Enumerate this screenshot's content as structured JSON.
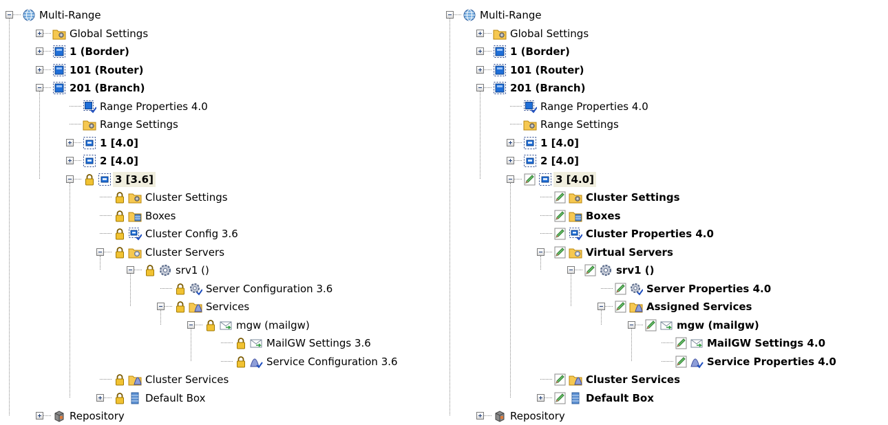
{
  "colors": {
    "accent_blue": "#1f6fd8",
    "selection_background": "#f0eede",
    "lock_yellow": "#f1c232",
    "folder_yellow": "#f6c851",
    "edit_green": "#4caf50"
  },
  "icons": {
    "lock": "lock-icon",
    "edit": "edit-pencil-icon",
    "globe": "globe-icon",
    "settings_folder": "settings-folder-icon",
    "range": "range-icon",
    "range_properties": "range-properties-icon",
    "cluster": "cluster-icon",
    "boxes_folder": "boxes-folder-icon",
    "cluster_config": "cluster-config-icon",
    "servers_folder": "servers-folder-icon",
    "server": "server-gear-icon",
    "server_config": "server-config-icon",
    "services_folder": "services-folder-icon",
    "mail_service": "mail-service-icon",
    "mail_settings": "mail-settings-icon",
    "service_config": "service-config-icon",
    "default_box": "default-box-icon",
    "repository": "repository-icon"
  },
  "left_tree": {
    "nodes": [
      {
        "label": "Multi-Range"
      },
      {
        "label": "Global Settings"
      },
      {
        "label": "1 (Border)"
      },
      {
        "label": "101 (Router)"
      },
      {
        "label": "201 (Branch)"
      },
      {
        "label": "Range Properties 4.0"
      },
      {
        "label": "Range Settings"
      },
      {
        "label": "1 [4.0]"
      },
      {
        "label": "2 [4.0]"
      },
      {
        "label": "3 [3.6]"
      },
      {
        "label": "Cluster Settings"
      },
      {
        "label": "Boxes"
      },
      {
        "label": "Cluster Config 3.6"
      },
      {
        "label": "Cluster Servers"
      },
      {
        "label": "srv1 ()"
      },
      {
        "label": "Server Configuration 3.6"
      },
      {
        "label": "Services"
      },
      {
        "label": "mgw (mailgw)"
      },
      {
        "label": "MailGW Settings 3.6"
      },
      {
        "label": "Service Configuration 3.6"
      },
      {
        "label": "Cluster Services"
      },
      {
        "label": "Default Box"
      },
      {
        "label": "Repository"
      }
    ]
  },
  "right_tree": {
    "nodes": [
      {
        "label": "Multi-Range"
      },
      {
        "label": "Global Settings"
      },
      {
        "label": "1 (Border)"
      },
      {
        "label": "101 (Router)"
      },
      {
        "label": "201 (Branch)"
      },
      {
        "label": "Range Properties 4.0"
      },
      {
        "label": "Range Settings"
      },
      {
        "label": "1 [4.0]"
      },
      {
        "label": "2 [4.0]"
      },
      {
        "label": "3 [4.0]"
      },
      {
        "label": "Cluster Settings"
      },
      {
        "label": "Boxes"
      },
      {
        "label": "Cluster Properties 4.0"
      },
      {
        "label": "Virtual Servers"
      },
      {
        "label": "srv1 ()"
      },
      {
        "label": "Server Properties 4.0"
      },
      {
        "label": "Assigned Services"
      },
      {
        "label": "mgw (mailgw)"
      },
      {
        "label": "MailGW Settings 4.0"
      },
      {
        "label": "Service Properties 4.0"
      },
      {
        "label": "Cluster Services"
      },
      {
        "label": "Default Box"
      },
      {
        "label": "Repository"
      }
    ]
  }
}
